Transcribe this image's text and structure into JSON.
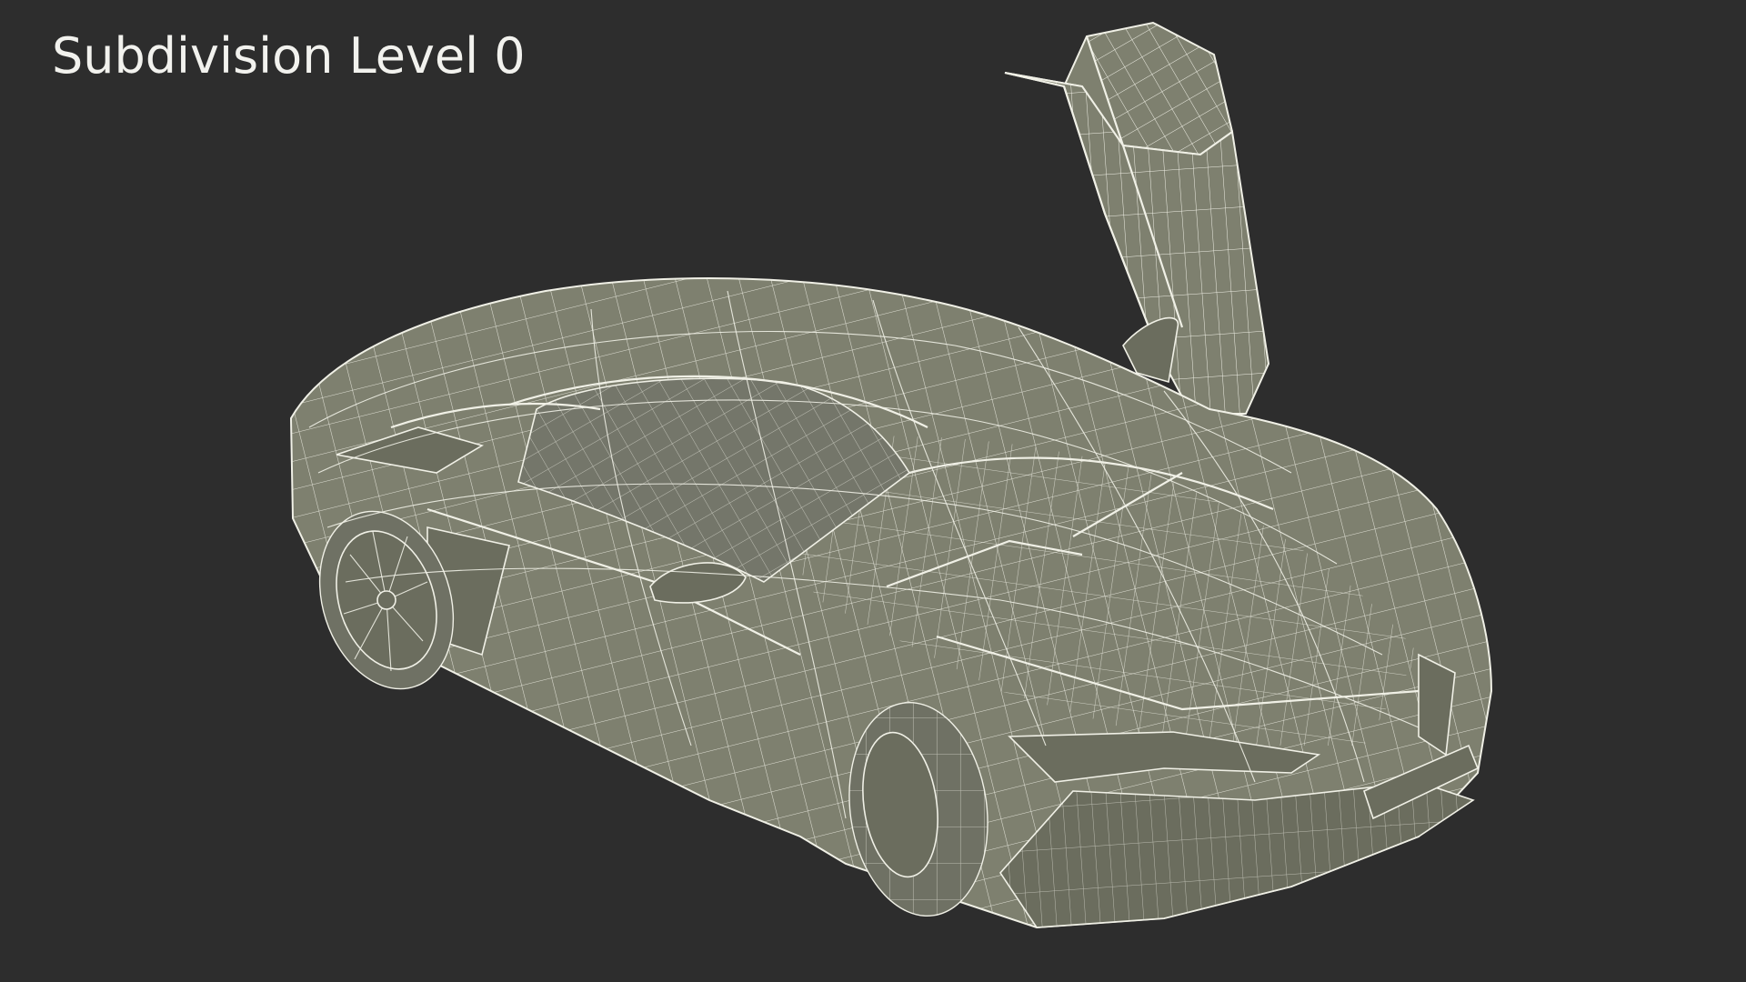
{
  "caption": {
    "text": "Subdivision Level 0"
  },
  "colors": {
    "background": "#2d2d2d",
    "model_fill": "#7e806f",
    "wireframe": "#f0f0e6",
    "caption": "#f2f2ee"
  }
}
